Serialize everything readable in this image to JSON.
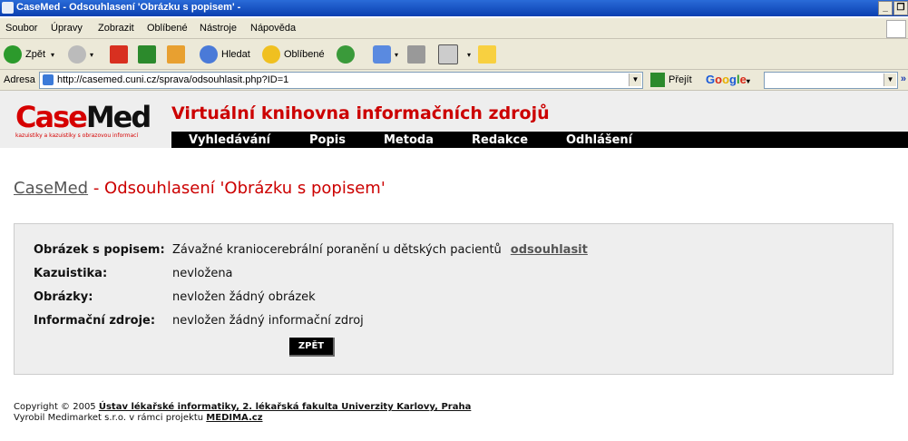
{
  "window": {
    "title": "CaseMed - Odsouhlasení 'Obrázku s popisem' -",
    "min_label": "_",
    "restore_label": "❐"
  },
  "menu": [
    "Soubor",
    "Úpravy",
    "Zobrazit",
    "Oblíbené",
    "Nástroje",
    "Nápověda"
  ],
  "toolbar": {
    "back_label": "Zpět",
    "search_label": "Hledat",
    "favorites_label": "Oblíbené"
  },
  "address": {
    "label": "Adresa",
    "url": "http://casemed.cuni.cz/sprava/odsouhlasit.php?ID=1",
    "go_label": "Přejít"
  },
  "google": {
    "dropdown": "▾"
  },
  "site": {
    "logo_case": "Case",
    "logo_med": "Med",
    "logo_tagline": "kazuistiky a kazuistiky s obrazovou informací",
    "title": "Virtuální knihovna informačních zdrojů",
    "nav": [
      "Vyhledávání",
      "Popis",
      "Metoda",
      "Redakce",
      "Odhlášení"
    ]
  },
  "breadcrumb": {
    "home": "CaseMed",
    "rest": " - Odsouhlasení 'Obrázku s popisem'"
  },
  "details": {
    "image_label": "Obrázek s popisem:",
    "image_value": "Závažné kraniocerebrální poranění u dětských pacientů",
    "approve_link": "odsouhlasit",
    "case_label": "Kazuistika:",
    "case_value": "nevložena",
    "images_label": "Obrázky:",
    "images_value": "nevložen žádný obrázek",
    "sources_label": "Informační zdroje:",
    "sources_value": "nevložen žádný informační zdroj",
    "back_button": "ZPĚT"
  },
  "footer": {
    "copyright_prefix": "Copyright © 2005",
    "copyright_link": "Ústav lékařské informatiky, 2. lékařská fakulta Univerzity Karlovy, Praha",
    "made_by": "Vyrobil Medimarket s.r.o. v rámci projektu",
    "project_link": "MEDIMA.cz"
  },
  "colors": {
    "brand_red": "#cc0000",
    "nav_bg": "#000000",
    "panel_bg": "#eeeeee"
  }
}
